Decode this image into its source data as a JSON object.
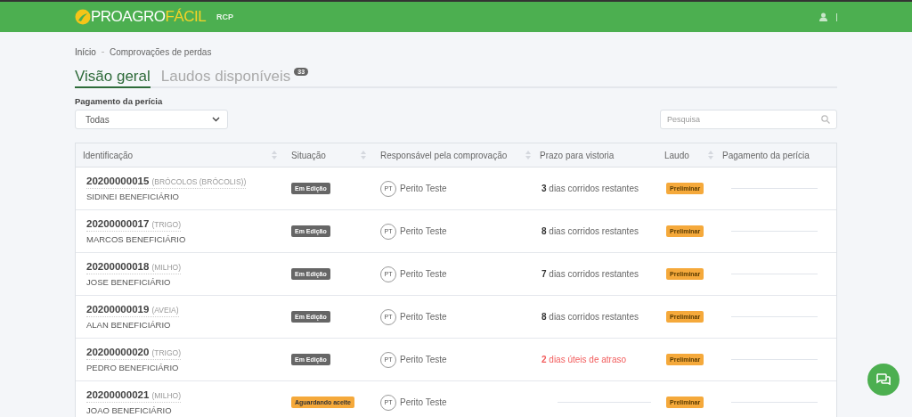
{
  "header": {
    "logo_primary": "PROAGRO",
    "logo_accent": "FÁCIL",
    "module": "RCP"
  },
  "breadcrumb": [
    "Início",
    "Comprovações de perdas"
  ],
  "tabs": [
    {
      "label": "Visão geral",
      "selected": true
    },
    {
      "label": "Laudos disponíveis",
      "selected": false,
      "badge": "33"
    }
  ],
  "filter": {
    "label": "Pagamento da perícia",
    "value": "Todas"
  },
  "search": {
    "placeholder": "Pesquisa"
  },
  "table": {
    "columns": [
      {
        "label": "Identificação",
        "sortable": true
      },
      {
        "label": "Situação",
        "sortable": true
      },
      {
        "label": "Responsável pela comprovação",
        "sortable": true
      },
      {
        "label": "Prazo para vistoria",
        "sortable": false
      },
      {
        "label": "Laudo",
        "sortable": true
      },
      {
        "label": "Pagamento da perícia",
        "sortable": false
      }
    ],
    "rows": [
      {
        "id": "20200000015",
        "crop": "(BRÓCOLOS (BRÓCOLIS))",
        "beneficiary": "SIDINEI BENEFICIÁRIO",
        "status": {
          "kind": "editing",
          "label": "Em Edição"
        },
        "initials": "PT",
        "responsible": "Perito Teste",
        "deadline": {
          "kind": "remaining",
          "count": "3",
          "text": "dias corridos restantes"
        },
        "report": "Preliminar"
      },
      {
        "id": "20200000017",
        "crop": "(TRIGO)",
        "beneficiary": "MARCOS BENEFICIÁRIO",
        "status": {
          "kind": "editing",
          "label": "Em Edição"
        },
        "initials": "PT",
        "responsible": "Perito Teste",
        "deadline": {
          "kind": "remaining",
          "count": "8",
          "text": "dias corridos restantes"
        },
        "report": "Preliminar"
      },
      {
        "id": "20200000018",
        "crop": "(MILHO)",
        "beneficiary": "JOSE BENEFICIÁRIO",
        "status": {
          "kind": "editing",
          "label": "Em Edição"
        },
        "initials": "PT",
        "responsible": "Perito Teste",
        "deadline": {
          "kind": "remaining",
          "count": "7",
          "text": "dias corridos restantes"
        },
        "report": "Preliminar"
      },
      {
        "id": "20200000019",
        "crop": "(AVEIA)",
        "beneficiary": "ALAN BENEFICIÁRIO",
        "status": {
          "kind": "editing",
          "label": "Em Edição"
        },
        "initials": "PT",
        "responsible": "Perito Teste",
        "deadline": {
          "kind": "remaining",
          "count": "8",
          "text": "dias corridos restantes"
        },
        "report": "Preliminar"
      },
      {
        "id": "20200000020",
        "crop": "(TRIGO)",
        "beneficiary": "PEDRO BENEFICIÁRIO",
        "status": {
          "kind": "editing",
          "label": "Em Edição"
        },
        "initials": "PT",
        "responsible": "Perito Teste",
        "deadline": {
          "kind": "late",
          "count": "2",
          "text": "dias úteis de atraso"
        },
        "report": "Preliminar"
      },
      {
        "id": "20200000021",
        "crop": "(MILHO)",
        "beneficiary": "JOAO BENEFICIÁRIO",
        "status": {
          "kind": "awaiting",
          "label": "Aguardando aceite"
        },
        "initials": "PT",
        "responsible": "Perito Teste",
        "report": "Preliminar"
      }
    ]
  }
}
